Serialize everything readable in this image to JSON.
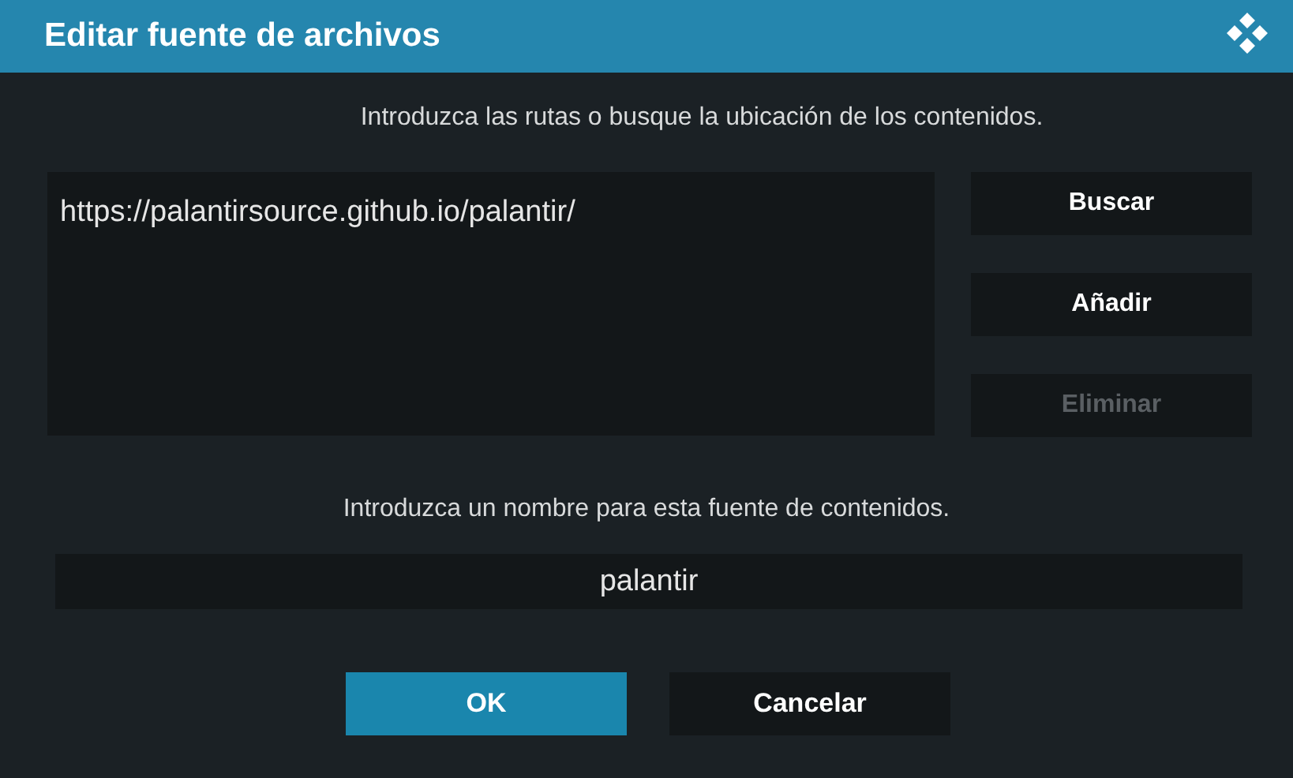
{
  "window": {
    "title": "Editar fuente de archivos"
  },
  "paths_label": "Introduzca las rutas o busque la ubicación de los contenidos.",
  "paths": [
    "https://palantirsource.github.io/palantir/"
  ],
  "side_buttons": [
    {
      "label": "Buscar",
      "disabled": false
    },
    {
      "label": "Añadir",
      "disabled": false
    },
    {
      "label": "Eliminar",
      "disabled": true
    }
  ],
  "name_label": "Introduzca un nombre para esta fuente de contenidos.",
  "name_field": {
    "value": "palantir"
  },
  "buttons": [
    {
      "label": "OK",
      "selected": true
    },
    {
      "label": "Cancelar",
      "selected": false
    }
  ]
}
